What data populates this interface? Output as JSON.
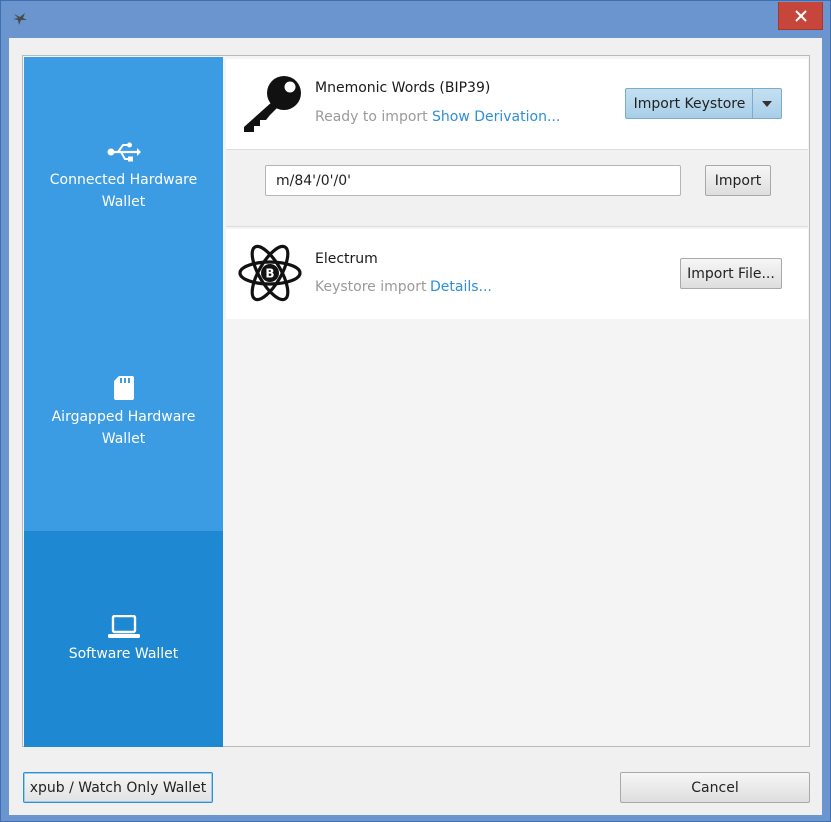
{
  "sidebar": {
    "items": [
      {
        "label": "Connected Hardware Wallet",
        "icon": "usb-icon",
        "active": false
      },
      {
        "label": "Airgapped Hardware Wallet",
        "icon": "sd-card-icon",
        "active": false
      },
      {
        "label": "Software Wallet",
        "icon": "laptop-icon",
        "active": true
      }
    ]
  },
  "keystores": {
    "mnemonic": {
      "title": "Mnemonic Words (BIP39)",
      "status": "Ready to import",
      "link": "Show Derivation...",
      "button": "Import Keystore",
      "derivation_value": "m/84'/0'/0'",
      "derivation_button": "Import"
    },
    "electrum": {
      "title": "Electrum",
      "status": "Keystore import",
      "link": "Details...",
      "button": "Import File..."
    }
  },
  "footer": {
    "xpub_button": "xpub / Watch Only Wallet",
    "cancel_button": "Cancel"
  },
  "colors": {
    "sidebar": "#3c9ce3",
    "sidebar_active": "#1e88d2",
    "link": "#2e8fd6",
    "titlebar": "#6b95cf",
    "close": "#c7463b"
  }
}
